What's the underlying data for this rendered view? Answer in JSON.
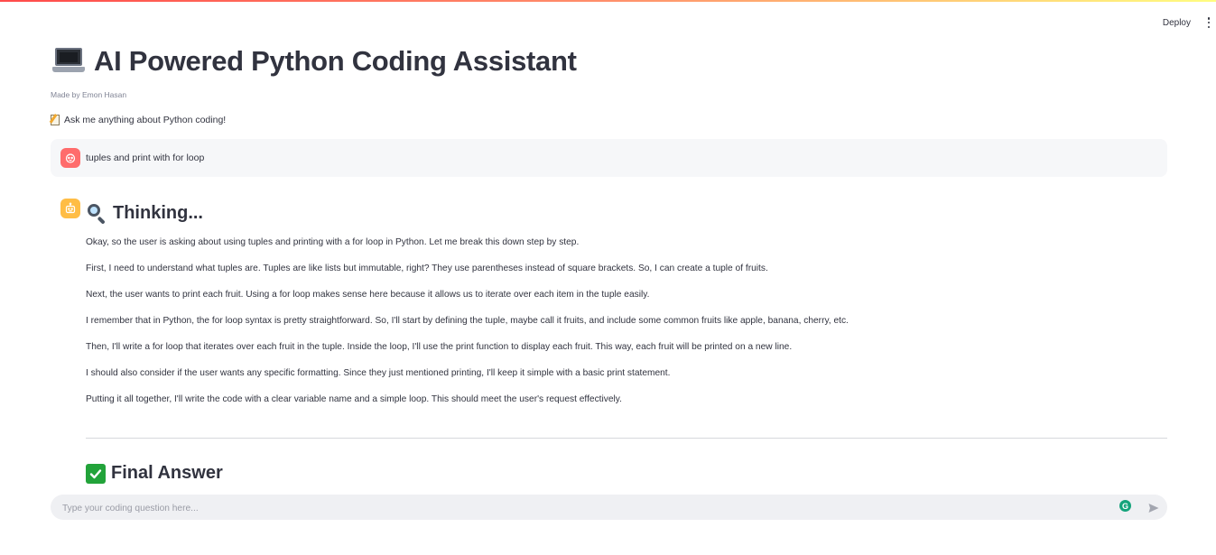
{
  "header": {
    "deploy_label": "Deploy",
    "menu_icon": "kebab-menu-icon"
  },
  "page": {
    "title_icon": "laptop-icon",
    "title": "AI Powered Python Coding Assistant",
    "subtitle": "Made by Emon Hasan",
    "prompt_icon": "memo-icon",
    "prompt": "Ask me anything about Python coding!"
  },
  "chat": {
    "user_message": "tuples and print with for loop",
    "assistant": {
      "thinking_heading": "Thinking...",
      "thinking_icon": "magnifying-glass-icon",
      "reasoning": [
        "Okay, so the user is asking about using tuples and printing with a for loop in Python. Let me break this down step by step.",
        "First, I need to understand what tuples are. Tuples are like lists but immutable, right? They use parentheses instead of square brackets. So, I can create a tuple of fruits.",
        "Next, the user wants to print each fruit. Using a for loop makes sense here because it allows us to iterate over each item in the tuple easily.",
        "I remember that in Python, the for loop syntax is pretty straightforward. So, I'll start by defining the tuple, maybe call it fruits, and include some common fruits like apple, banana, cherry, etc.",
        "Then, I'll write a for loop that iterates over each fruit in the tuple. Inside the loop, I'll use the print function to display each fruit. This way, each fruit will be printed on a new line.",
        "I should also consider if the user wants any specific formatting. Since they just mentioned printing, I'll keep it simple with a basic print statement.",
        "Putting it all together, I'll write the code with a clear variable name and a simple loop. This should meet the user's request effectively."
      ],
      "final_heading": "Final Answer",
      "final_icon": "check-mark-icon"
    }
  },
  "input": {
    "placeholder": "Type your coding question here...",
    "value": ""
  },
  "colors": {
    "user_avatar": "#ff6c6c",
    "bot_avatar": "#ffbd45",
    "check": "#22a33a"
  }
}
